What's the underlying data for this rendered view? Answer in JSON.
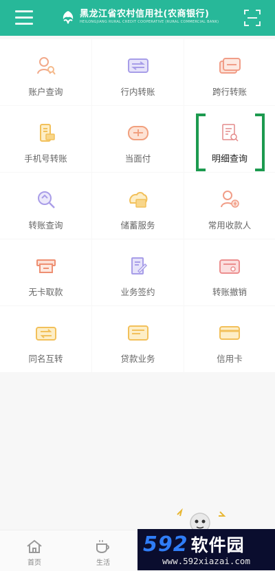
{
  "header": {
    "bank_name": "黑龙江省农村信用社(农商银行)",
    "bank_name_en": "HEILONGJIANG RURAL CREDIT COOPERATIVE (RURAL COMMERCIAL BANK)"
  },
  "grid": {
    "items": [
      {
        "label": "账户查询",
        "icon": "account-query-icon"
      },
      {
        "label": "行内转账",
        "icon": "intra-bank-transfer-icon"
      },
      {
        "label": "跨行转账",
        "icon": "inter-bank-transfer-icon"
      },
      {
        "label": "手机号转账",
        "icon": "phone-transfer-icon"
      },
      {
        "label": "当面付",
        "icon": "face-pay-icon"
      },
      {
        "label": "明细查询",
        "icon": "detail-query-icon"
      },
      {
        "label": "转账查询",
        "icon": "transfer-query-icon"
      },
      {
        "label": "储蓄服务",
        "icon": "savings-service-icon"
      },
      {
        "label": "常用收款人",
        "icon": "payee-icon"
      },
      {
        "label": "无卡取款",
        "icon": "cardless-withdrawal-icon"
      },
      {
        "label": "业务签约",
        "icon": "business-sign-icon"
      },
      {
        "label": "转账撤销",
        "icon": "transfer-cancel-icon"
      },
      {
        "label": "同名互转",
        "icon": "same-name-transfer-icon"
      },
      {
        "label": "贷款业务",
        "icon": "loan-icon"
      },
      {
        "label": "信用卡",
        "icon": "credit-card-icon"
      }
    ]
  },
  "bottom_nav": {
    "items": [
      {
        "label": "首页",
        "icon": "home-icon"
      },
      {
        "label": "生活",
        "icon": "life-icon"
      }
    ]
  },
  "watermark": {
    "number": "592",
    "text": "软件园",
    "url": "www.592xiazai.com"
  }
}
